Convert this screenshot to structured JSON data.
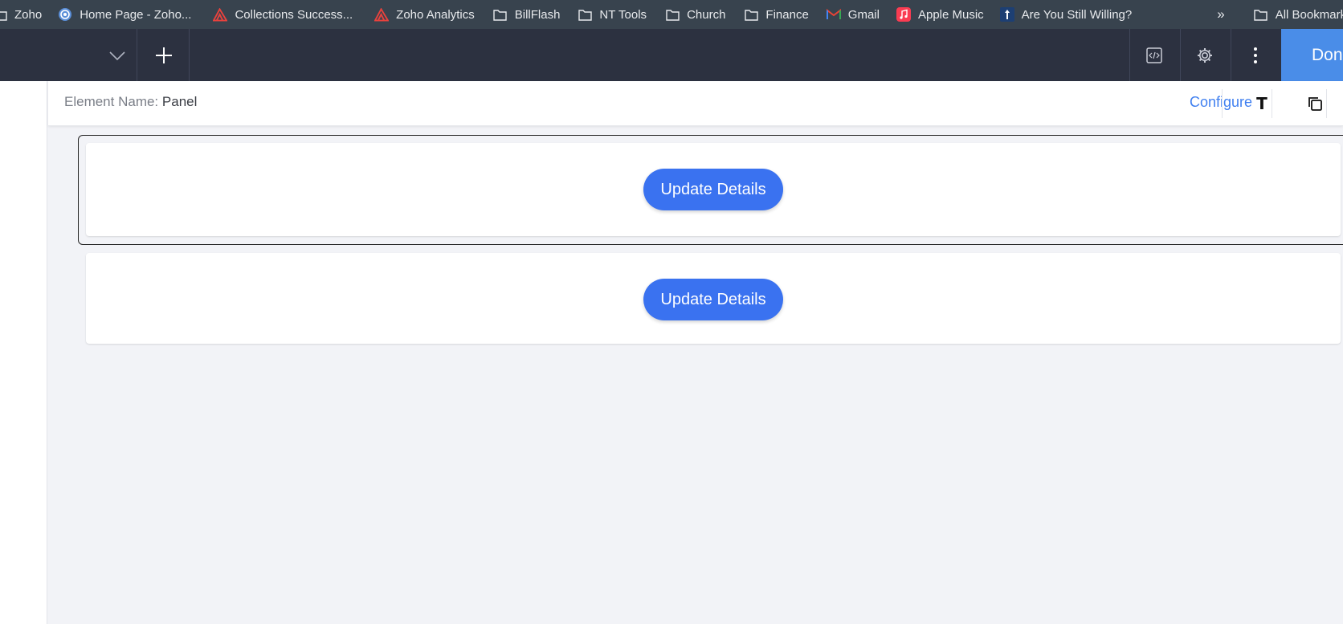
{
  "bookmarks": {
    "items": [
      {
        "label": "Zoho",
        "icon": "folder-icon"
      },
      {
        "label": "Home Page - Zoho...",
        "icon": "zoho-desk-icon"
      },
      {
        "label": "Collections Success...",
        "icon": "zoho-analytics-icon"
      },
      {
        "label": "Zoho Analytics",
        "icon": "zoho-analytics-icon"
      },
      {
        "label": "BillFlash",
        "icon": "folder-icon"
      },
      {
        "label": "NT Tools",
        "icon": "folder-icon"
      },
      {
        "label": "Church",
        "icon": "folder-icon"
      },
      {
        "label": "Finance",
        "icon": "folder-icon"
      },
      {
        "label": "Gmail",
        "icon": "gmail-icon"
      },
      {
        "label": "Apple Music",
        "icon": "apple-music-icon"
      },
      {
        "label": "Are You Still Willing?",
        "icon": "site-favicon"
      }
    ],
    "overflow": "»",
    "all_bookmarks": "All Bookmarks"
  },
  "toolbar": {
    "done_label": "Done"
  },
  "element_header": {
    "name_label": "Element Name:",
    "name_value": "Panel",
    "configure_label": "Configure",
    "text_icon_glyph": "T"
  },
  "panels": [
    {
      "button_label": "Update Details"
    },
    {
      "button_label": "Update Details"
    }
  ],
  "colors": {
    "bookmarks_bg": "#38434e",
    "toolbar_bg": "#2c3140",
    "done_bg": "#4a8de8",
    "accent_link": "#3f7ff0",
    "button_bg": "#3a72f0",
    "canvas_bg": "#f2f3f7"
  }
}
